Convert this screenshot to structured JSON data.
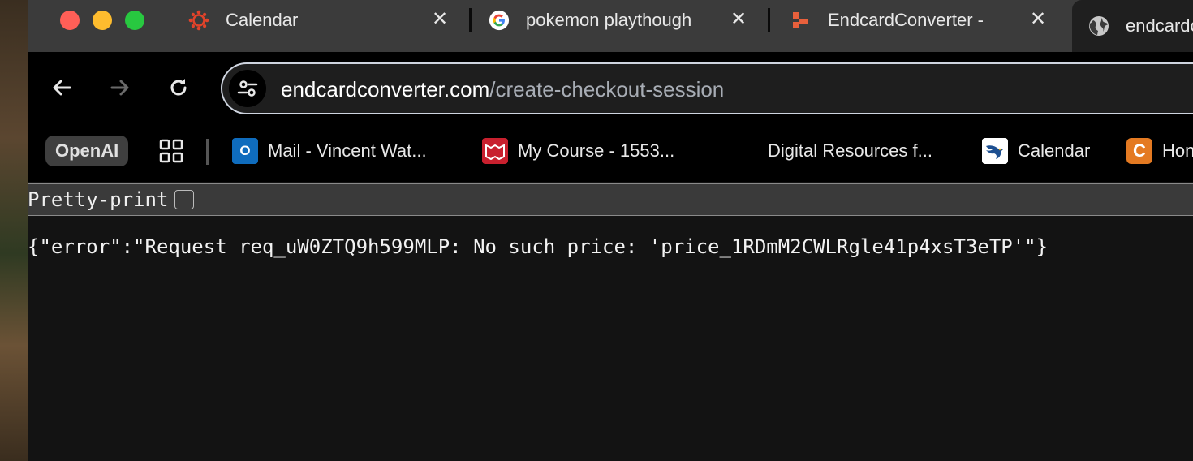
{
  "tabs": [
    {
      "title": "Calendar",
      "icon": "canvas-logo-icon"
    },
    {
      "title": "pokemon playthough",
      "icon": "google-g-icon"
    },
    {
      "title": "EndcardConverter -",
      "icon": "endcard-logo-icon"
    }
  ],
  "active_tab": {
    "title": "endcardconverter",
    "icon": "globe-icon"
  },
  "toolbar": {
    "back_icon": "arrow-left-icon",
    "forward_icon": "arrow-right-icon",
    "reload_icon": "reload-icon",
    "url_host": "endcardconverter.com",
    "url_path": "/create-checkout-session"
  },
  "bookmarks": {
    "openai": "OpenAI",
    "mail": "Mail - Vincent Wat...",
    "course": "My Course - 1553...",
    "digital": "Digital Resources f...",
    "calendar": "Calendar",
    "home": "Hon",
    "home_icon_letter": "C"
  },
  "content": {
    "pretty_print_label": "Pretty-print",
    "response_text": "{\"error\":\"Request req_uW0ZTQ9h599MLP: No such price: 'price_1RDmM2CWLRgle41p4xsT3eTP'\"}"
  },
  "colors": {
    "tab_strip": "#3b3b3b",
    "toolbar": "#000000",
    "page_bg": "#131313",
    "omnibox_border": "#cfd5e0",
    "traffic_red": "#ff5f57",
    "traffic_yellow": "#febc2e",
    "traffic_green": "#28c840"
  }
}
